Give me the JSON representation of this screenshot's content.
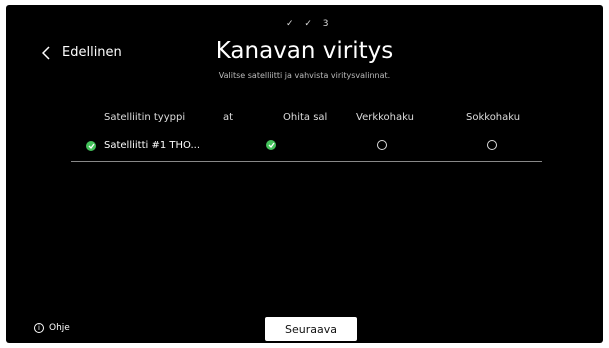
{
  "steps": "✓ ✓ 3",
  "back_label": "Edellinen",
  "title": "Kanavan viritys",
  "subtitle": "Valitse satelliitti ja vahvista viritysvalinnat.",
  "table": {
    "headers": [
      "Satelliitin tyyppi",
      "at",
      "Ohita sal",
      "Verkkohaku",
      "Sokkohaku"
    ],
    "row": {
      "satellite": "Satelliitti #1 THO...",
      "satellite_selected": true,
      "skip_selected": true,
      "network_search": false,
      "blind_search": false
    }
  },
  "help_label": "Ohje",
  "help_icon_glyph": "i",
  "next_label": "Seuraava",
  "colors": {
    "check": "#43c15a",
    "background": "#000000"
  }
}
